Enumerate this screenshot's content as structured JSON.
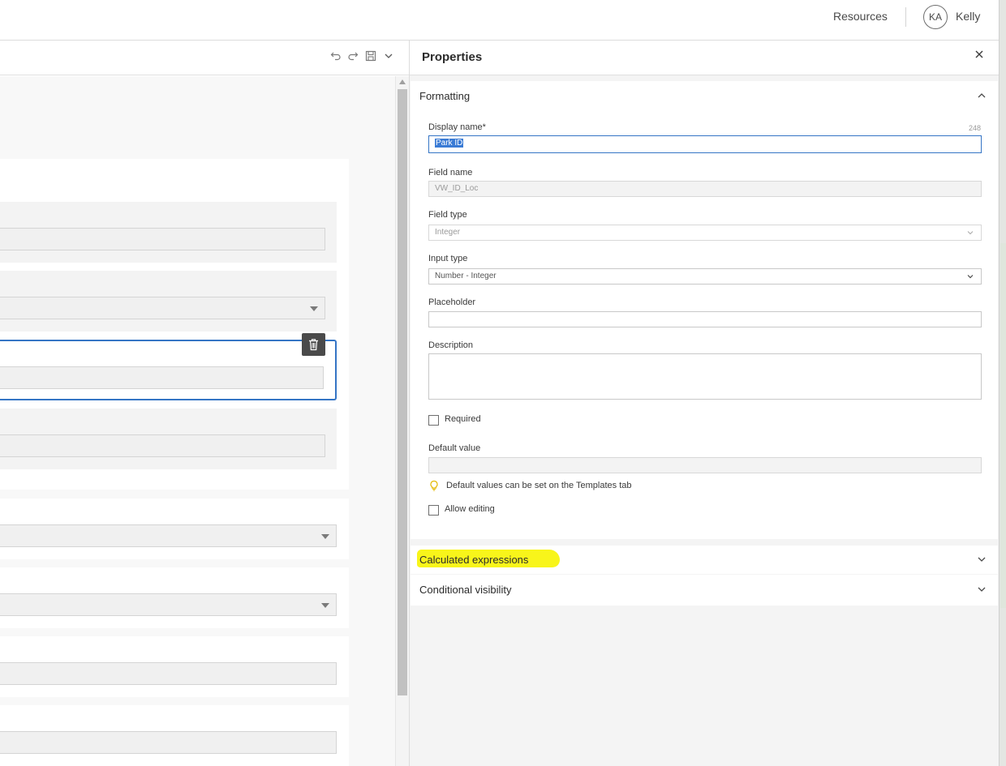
{
  "header": {
    "resources_label": "Resources",
    "avatar_initials": "KA",
    "user_name": "Kelly"
  },
  "toolbar": {
    "undo_icon": "undo-icon",
    "redo_icon": "redo-icon",
    "save_icon": "save-icon",
    "menu_icon": "chevron-down-icon"
  },
  "properties": {
    "title": "Properties",
    "close_icon": "close-icon",
    "formatting": {
      "title": "Formatting",
      "display_name_label": "Display name*",
      "display_name_counter": "248",
      "display_name_value": "Park ID",
      "field_name_label": "Field name",
      "field_name_value": "VW_ID_Loc",
      "field_type_label": "Field type",
      "field_type_value": "Integer",
      "input_type_label": "Input type",
      "input_type_value": "Number - Integer",
      "placeholder_label": "Placeholder",
      "placeholder_value": "",
      "description_label": "Description",
      "description_value": "",
      "required_label": "Required",
      "required_checked": false,
      "default_value_label": "Default value",
      "default_value_value": "",
      "default_hint": "Default values can be set on the Templates tab",
      "allow_editing_label": "Allow editing",
      "allow_editing_checked": false
    },
    "calculated_expressions_title": "Calculated expressions",
    "conditional_visibility_title": "Conditional visibility"
  },
  "colors": {
    "accent": "#3575c5",
    "highlight": "#f8f51a",
    "selection": "#3a7bd5"
  }
}
